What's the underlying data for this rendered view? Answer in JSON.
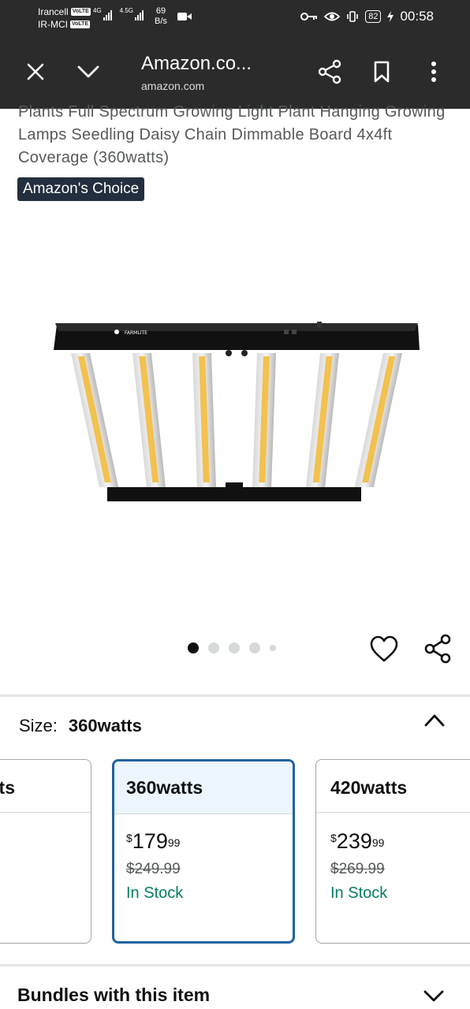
{
  "status_bar": {
    "carrier_1": "Irancell",
    "carrier_2": "IR-MCI",
    "volte_badge": "VoLTE",
    "network_1": "4G",
    "network_2": "4.5G",
    "speed_value": "69",
    "speed_unit": "B/s",
    "battery": "82",
    "time": "00:58"
  },
  "browser": {
    "title": "Amazon.co...",
    "domain": "amazon.com",
    "icons": [
      "close-icon",
      "chevron-down-icon",
      "share-icon",
      "bookmark-icon",
      "more-vert-icon"
    ]
  },
  "product": {
    "title": "Plants Full Spectrum Growing Light Plant Hanging Growing Lamps Seedling Daisy Chain Dimmable Board 4x4ft Coverage (360watts)",
    "badge": "Amazon's Choice",
    "image_logo_text": "FARMLITE",
    "image_count": 5,
    "active_image_index": 0
  },
  "size_section": {
    "label": "Size:",
    "selected_value": "360watts",
    "variants": [
      {
        "name": "...ts",
        "selected": false
      },
      {
        "name": "360watts",
        "price_symbol": "$",
        "price_whole": "179",
        "price_cents": "99",
        "list_price": "$249.99",
        "stock": "In Stock",
        "selected": true
      },
      {
        "name": "420watts",
        "price_symbol": "$",
        "price_whole": "239",
        "price_cents": "99",
        "list_price": "$269.99",
        "stock": "In Stock",
        "selected": false
      }
    ]
  },
  "bundles": {
    "title": "Bundles with this item"
  },
  "colors": {
    "top_bar_bg": "#2b2b2b",
    "badge_bg": "#232f3e",
    "selected_border": "#2162a1",
    "selected_header_bg": "#edf6ff",
    "in_stock": "#067d62"
  }
}
